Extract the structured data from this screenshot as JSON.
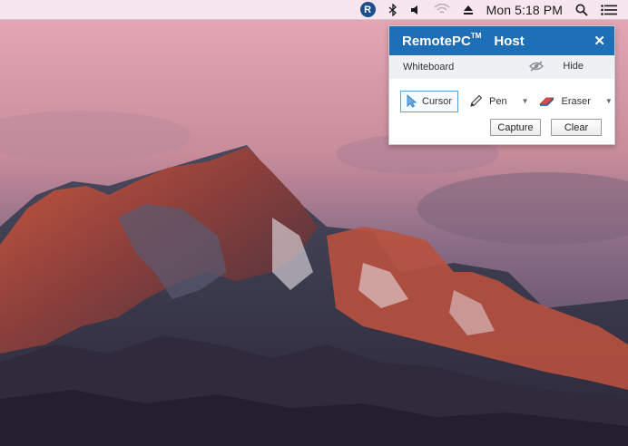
{
  "menubar": {
    "app_icon_letter": "R",
    "clock": "Mon 5:18 PM",
    "icons": [
      "remotepc-app-icon",
      "bluetooth-icon",
      "volume-icon",
      "wifi-icon",
      "eject-icon",
      "spotlight-search-icon",
      "notification-center-icon"
    ]
  },
  "panel": {
    "brand": "RemotePC",
    "trademark": "TM",
    "host": "Host",
    "close_glyph": "✕",
    "whiteboard_label": "Whiteboard",
    "hide_label": "Hide",
    "tools": {
      "cursor_label": "Cursor",
      "pen_label": "Pen",
      "eraser_label": "Eraser"
    },
    "capture_label": "Capture",
    "clear_label": "Clear"
  },
  "colors": {
    "header_blue": "#1f6fb6",
    "active_border": "#5aa0dd"
  }
}
